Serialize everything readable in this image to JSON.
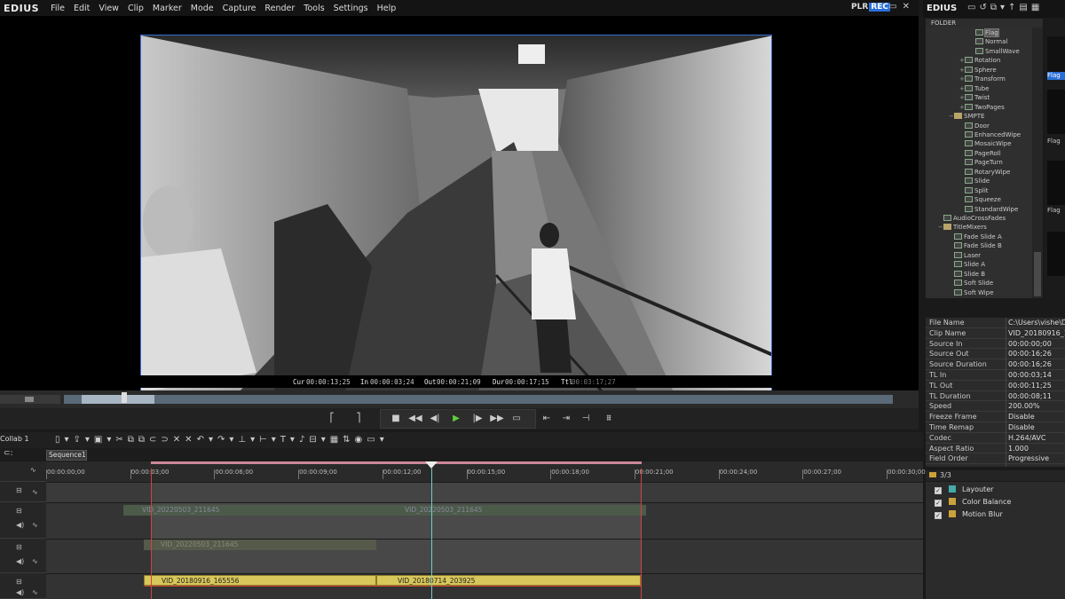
{
  "app": {
    "logo": "EDIUS",
    "menu": [
      "File",
      "Edit",
      "View",
      "Clip",
      "Marker",
      "Mode",
      "Capture",
      "Render",
      "Tools",
      "Settings",
      "Help"
    ],
    "plr": "PLR",
    "rec": "REC"
  },
  "timecodes": {
    "cur_label": "Cur",
    "cur": "00:00:13;25",
    "in_label": "In",
    "in": "00:00:03;24",
    "out_label": "Out",
    "out": "00:00:21;09",
    "dur_label": "Dur",
    "dur": "00:00:17;15",
    "ttl_label": "Ttl",
    "ttl": "00:03:17;27"
  },
  "bin": {
    "logo": "EDIUS",
    "folder_header": "FOLDER",
    "tree": [
      {
        "label": "Flag",
        "indent": 3,
        "selected": true
      },
      {
        "label": "Normal",
        "indent": 3
      },
      {
        "label": "SmallWave",
        "indent": 3
      },
      {
        "label": "Rotation",
        "indent": 2,
        "exp": "+"
      },
      {
        "label": "Sphere",
        "indent": 2,
        "exp": "+"
      },
      {
        "label": "Transform",
        "indent": 2,
        "exp": "+"
      },
      {
        "label": "Tube",
        "indent": 2,
        "exp": "+"
      },
      {
        "label": "Twist",
        "indent": 2,
        "exp": "+"
      },
      {
        "label": "TwoPages",
        "indent": 2,
        "exp": "+"
      },
      {
        "label": "SMPTE",
        "indent": 1,
        "exp": "−",
        "folder": true
      },
      {
        "label": "Door",
        "indent": 2
      },
      {
        "label": "EnhancedWipe",
        "indent": 2
      },
      {
        "label": "MosaicWipe",
        "indent": 2
      },
      {
        "label": "PageRoll",
        "indent": 2
      },
      {
        "label": "PageTurn",
        "indent": 2
      },
      {
        "label": "RotaryWipe",
        "indent": 2
      },
      {
        "label": "Slide",
        "indent": 2
      },
      {
        "label": "Split",
        "indent": 2
      },
      {
        "label": "Squeeze",
        "indent": 2
      },
      {
        "label": "StandardWipe",
        "indent": 2
      },
      {
        "label": "AudioCrossFades",
        "indent": 0
      },
      {
        "label": "TitleMixers",
        "indent": 0,
        "exp": "−",
        "folder": true
      },
      {
        "label": "Fade Slide A",
        "indent": 1
      },
      {
        "label": "Fade Slide B",
        "indent": 1
      },
      {
        "label": "Laser",
        "indent": 1
      },
      {
        "label": "Slide A",
        "indent": 1
      },
      {
        "label": "Slide B",
        "indent": 1
      },
      {
        "label": "Soft Slide",
        "indent": 1
      },
      {
        "label": "Soft Wipe",
        "indent": 1
      }
    ],
    "thumb_labels": [
      "Flag",
      "Flag",
      "Flag"
    ]
  },
  "properties": [
    {
      "k": "File Name",
      "v": "C:\\Users\\vishe\\Da"
    },
    {
      "k": "Clip Name",
      "v": "VID_20180916_165"
    },
    {
      "k": "Source In",
      "v": "00:00:00;00"
    },
    {
      "k": "Source Out",
      "v": "00:00:16;26"
    },
    {
      "k": "Source Duration",
      "v": "00:00:16;26"
    },
    {
      "k": "TL In",
      "v": "00:00:03;14"
    },
    {
      "k": "TL Out",
      "v": "00:00:11;25"
    },
    {
      "k": "TL Duration",
      "v": "00:00:08;11"
    },
    {
      "k": "Speed",
      "v": "200.00%"
    },
    {
      "k": "Freeze Frame",
      "v": "Disable"
    },
    {
      "k": "Time Remap",
      "v": "Disable"
    },
    {
      "k": "Codec",
      "v": "H.264/AVC"
    },
    {
      "k": "Aspect Ratio",
      "v": "1.000"
    },
    {
      "k": "Field Order",
      "v": "Progressive"
    }
  ],
  "effects": {
    "count": "3/3",
    "items": [
      {
        "label": "Layouter",
        "color": "#4aa"
      },
      {
        "label": "Color Balance",
        "color": "#c9a23a"
      },
      {
        "label": "Motion Blur",
        "color": "#c9a23a"
      }
    ]
  },
  "timeline": {
    "mode": "Collab 1",
    "mode2": "nd",
    "sequence": "Sequence1",
    "ruler": [
      "00:00:00;00",
      "00:00:03;00",
      "00:00:06;00",
      "00:00:09;00",
      "00:00:12;00",
      "00:00:15;00",
      "00:00:18;00",
      "00:00:21;00",
      "00:00:24;00",
      "00:00:27;00",
      "00:00:30;00"
    ],
    "clips": {
      "a1": "VID_20220503_211645",
      "a2": "VID_20220503_211645",
      "a3": "VID_20220503_211645",
      "v1": "VID_20180916_165556",
      "v2": "VID_20180714_203925"
    }
  }
}
